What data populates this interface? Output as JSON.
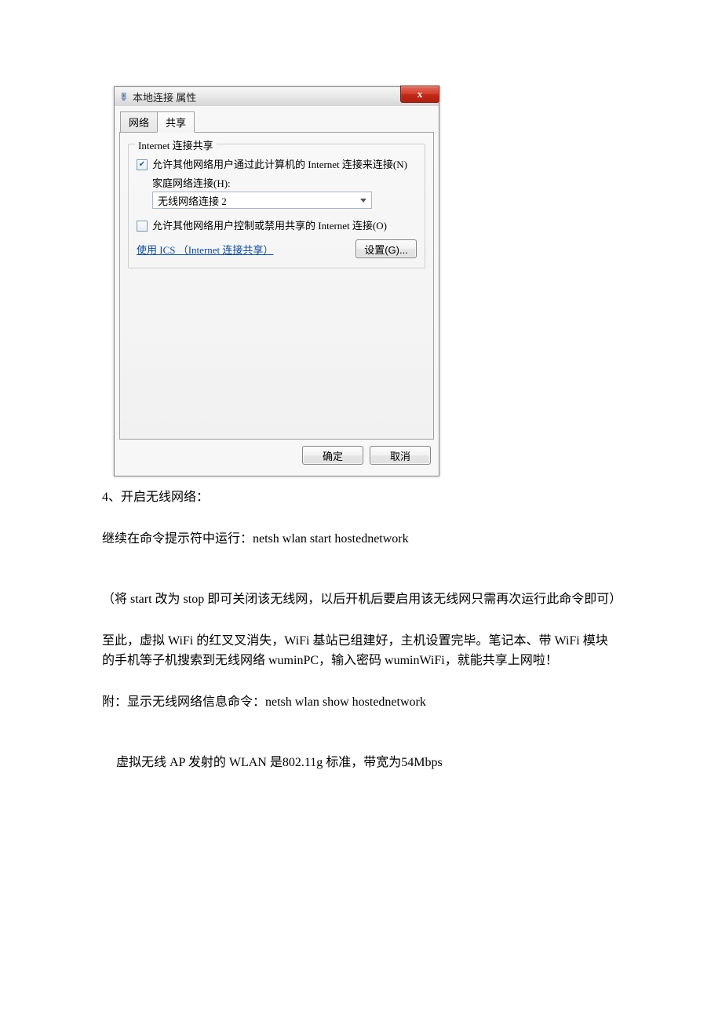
{
  "dialog": {
    "title": "本地连接 属性",
    "close_label": "x",
    "tabs": {
      "network": "网络",
      "sharing": "共享"
    },
    "group": {
      "legend": "Internet 连接共享",
      "allow1": "允许其他网络用户通过此计算机的 Internet 连接来连接(N)",
      "home_label": "家庭网络连接(H):",
      "home_value": "无线网络连接 2",
      "allow2": "允许其他网络用户控制或禁用共享的 Internet 连接(O)",
      "ics_link": "使用 ICS （Internet 连接共享）",
      "settings_btn": "设置(G)..."
    },
    "ok": "确定",
    "cancel": "取消"
  },
  "doc": {
    "step4": "4、开启无线网络：",
    "p1": "继续在命令提示符中运行：netsh  wlan  start  hostednetwork",
    "p2": "（将 start 改为 stop 即可关闭该无线网，以后开机后要启用该无线网只需再次运行此命令即可）",
    "p3": "至此，虚拟 WiFi 的红叉叉消失，WiFi 基站已组建好，主机设置完毕。笔记本、带 WiFi 模块的手机等子机搜索到无线网络 wuminPC，输入密码 wuminWiFi，就能共享上网啦！",
    "p4": "附：显示无线网络信息命令：netsh  wlan  show  hostednetwork",
    "p5": "虚拟无线 AP 发射的 WLAN 是802.11g 标准，带宽为54Mbps"
  }
}
